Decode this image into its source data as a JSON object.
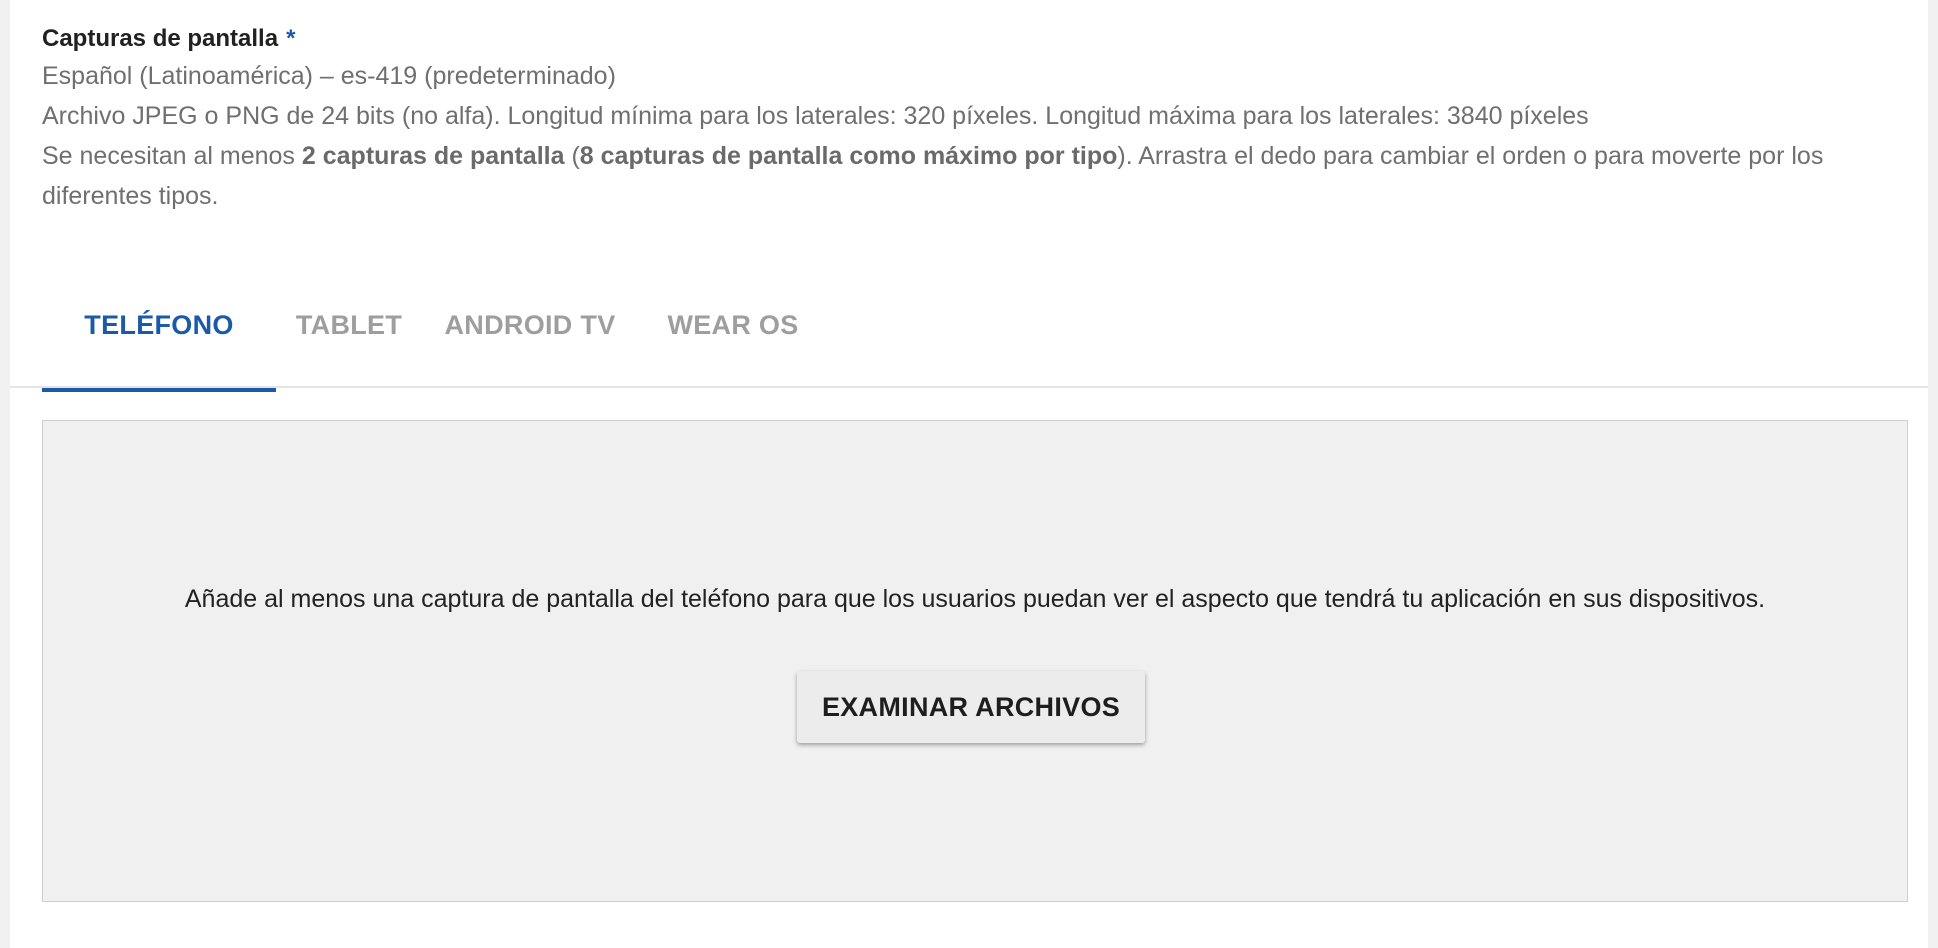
{
  "section": {
    "title": "Capturas de pantalla",
    "required_mark": "*",
    "language": "Español (Latinoamérica) – es-419 (predeterminado)",
    "format_info": "Archivo JPEG o PNG de 24 bits (no alfa). Longitud mínima para los laterales: 320 píxeles. Longitud máxima para los laterales: 3840 píxeles",
    "requirement": {
      "part1": "Se necesitan al menos ",
      "bold1": "2 capturas de pantalla",
      "part2": " (",
      "bold2": "8 capturas de pantalla como máximo por tipo",
      "part3": "). Arrastra el dedo para cambiar el orden o para moverte por los diferentes tipos."
    }
  },
  "tabs": [
    {
      "label": "TELÉFONO",
      "active": true
    },
    {
      "label": "TABLET",
      "active": false
    },
    {
      "label": "ANDROID TV",
      "active": false
    },
    {
      "label": "WEAR OS",
      "active": false
    }
  ],
  "dropzone": {
    "message": "Añade al menos una captura de pantalla del teléfono para que los usuarios puedan ver el aspecto que tendrá tu aplicación en sus dispositivos.",
    "browse_label": "EXAMINAR ARCHIVOS"
  },
  "colors": {
    "accent": "#1a5aa8",
    "inactive_tab": "#9e9e9e",
    "dropzone_bg": "#f0f0f0"
  }
}
